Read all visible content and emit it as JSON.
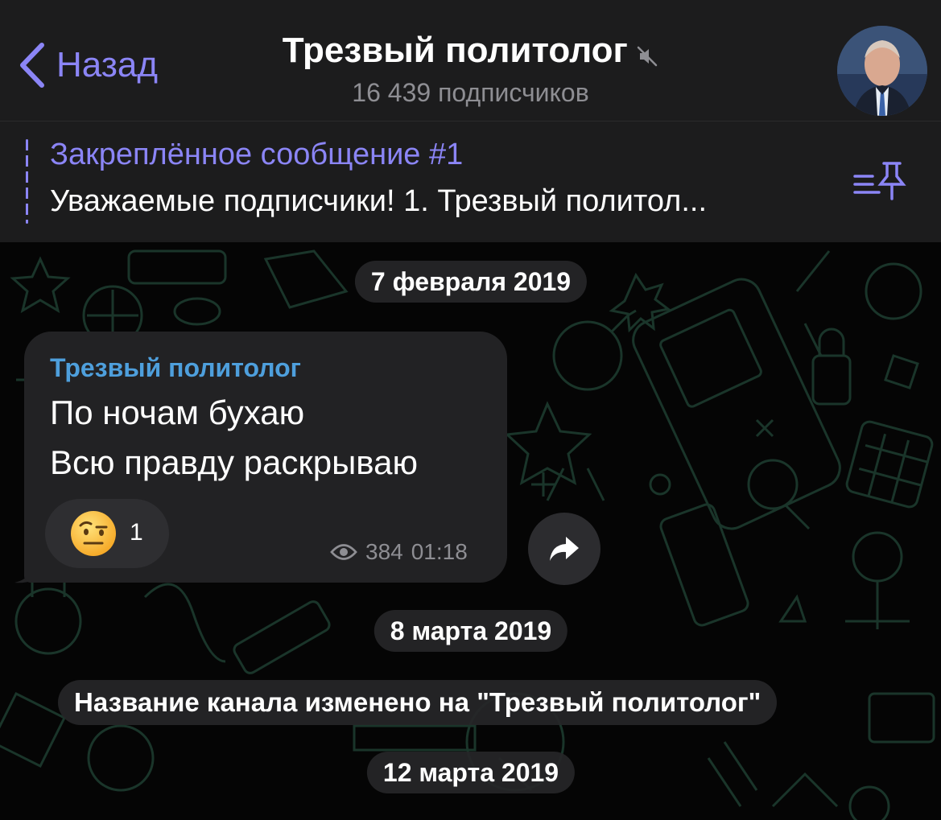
{
  "header": {
    "back_label": "Назад",
    "title": "Трезвый политолог",
    "subtitle": "16 439 подписчиков"
  },
  "pinned": {
    "title": "Закреплённое сообщение #1",
    "text": "Уважаемые подписчики! 1. Трезвый политол..."
  },
  "chat": {
    "dates": [
      "7 февраля 2019",
      "8 марта 2019",
      "12 марта 2019"
    ],
    "message": {
      "author": "Трезвый политолог",
      "lines": [
        "По ночам бухаю",
        "Всю правду раскрываю"
      ],
      "reaction_count": "1",
      "views": "384",
      "time": "01:18"
    },
    "service_message": "Название канала изменено на \"Трезвый политолог\""
  },
  "colors": {
    "accent": "#8b85f6",
    "author": "#4e9fdc",
    "bubble": "#222224",
    "header_bg": "#1c1c1d"
  },
  "icons": [
    "chevron-left-icon",
    "mute-icon",
    "pin-list-icon",
    "eye-icon",
    "share-icon",
    "emoji-raised-eyebrow-icon"
  ]
}
